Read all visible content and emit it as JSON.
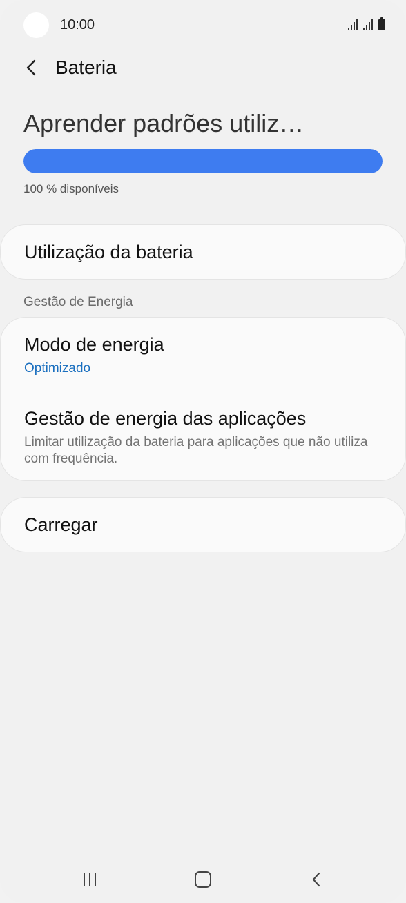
{
  "status_bar": {
    "time": "10:00"
  },
  "header": {
    "title": "Bateria",
    "back_icon": "chevron-left-icon"
  },
  "battery": {
    "heading": "Aprender padrões utiliz…",
    "level_percent": 100,
    "available_text": "100 % disponíveis",
    "bar_color": "#3e7cf0"
  },
  "items": {
    "usage": {
      "title": "Utilização da bateria"
    },
    "section_label": "Gestão de Energia",
    "power_mode": {
      "title": "Modo de energia",
      "value": "Optimizado",
      "value_color": "#1a6fbf"
    },
    "app_power": {
      "title": "Gestão de energia das aplicações",
      "description": "Limitar utilização da bateria para aplicações que não utiliza com frequência."
    },
    "charging": {
      "title": "Carregar"
    }
  },
  "nav_bar": {
    "recent_icon": "recent-apps-icon",
    "home_icon": "home-icon",
    "back_icon": "back-icon"
  }
}
